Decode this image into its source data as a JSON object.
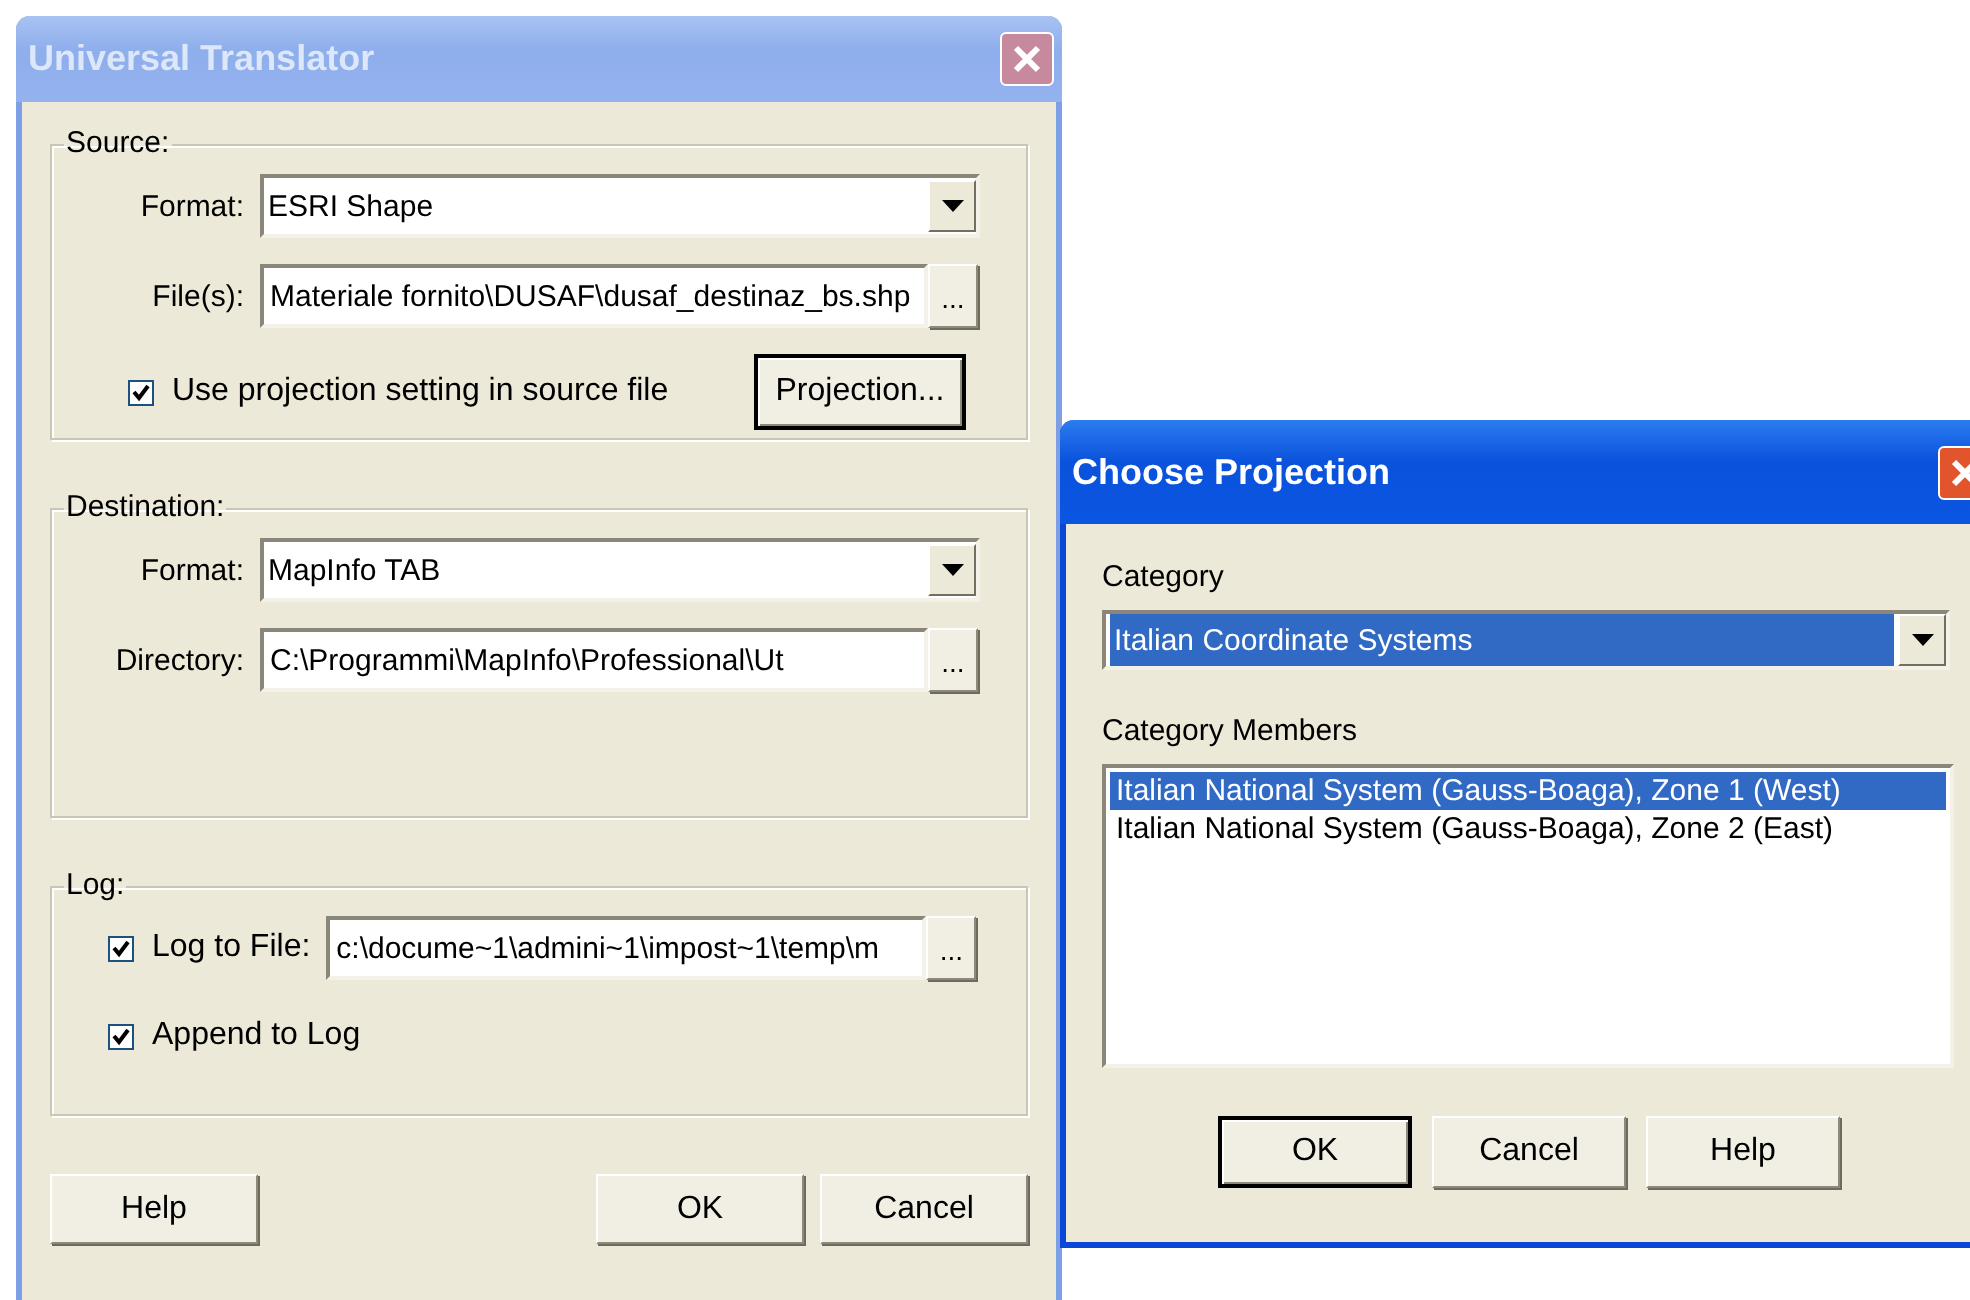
{
  "translator": {
    "title": "Universal Translator",
    "active": false,
    "groups": [
      {
        "label": "Source:",
        "rows": [
          {
            "kind": "dropdown",
            "label": "Format:",
            "value": "ESRI Shape"
          },
          {
            "kind": "path",
            "label": "File(s):",
            "value": "Materiale fornito\\DUSAF\\dusaf_destinaz_bs.shp",
            "browse": "..."
          },
          {
            "kind": "check_button",
            "label": "Use projection setting in source file",
            "checked": true,
            "button": "Projection..."
          }
        ]
      },
      {
        "label": "Destination:",
        "rows": [
          {
            "kind": "dropdown",
            "label": "Format:",
            "value": "MapInfo TAB"
          },
          {
            "kind": "path",
            "label": "Directory:",
            "value": "C:\\Programmi\\MapInfo\\Professional\\Ut",
            "browse": "..."
          }
        ]
      },
      {
        "label": "Log:",
        "rows": [
          {
            "kind": "check_path",
            "label": "Log to File:",
            "checked": true,
            "value": "c:\\docume~1\\admini~1\\impost~1\\temp\\m",
            "browse": "..."
          },
          {
            "kind": "check",
            "label": "Append to Log",
            "checked": true
          }
        ]
      }
    ],
    "buttons": [
      {
        "label": "Help",
        "default": false
      },
      {
        "label": "OK",
        "default": false
      },
      {
        "label": "Cancel",
        "default": false
      }
    ]
  },
  "choose_projection": {
    "title": "Choose Projection",
    "active": true,
    "category_label": "Category",
    "category": "Italian Coordinate Systems",
    "members_label": "Category Members",
    "members": [
      {
        "label": "Italian National System (Gauss-Boaga), Zone 1 (West)",
        "selected": true
      },
      {
        "label": "Italian National System (Gauss-Boaga), Zone 2 (East)",
        "selected": false
      }
    ],
    "buttons": [
      {
        "label": "OK",
        "default": true
      },
      {
        "label": "Cancel",
        "default": false
      },
      {
        "label": "Help",
        "default": false
      }
    ]
  }
}
